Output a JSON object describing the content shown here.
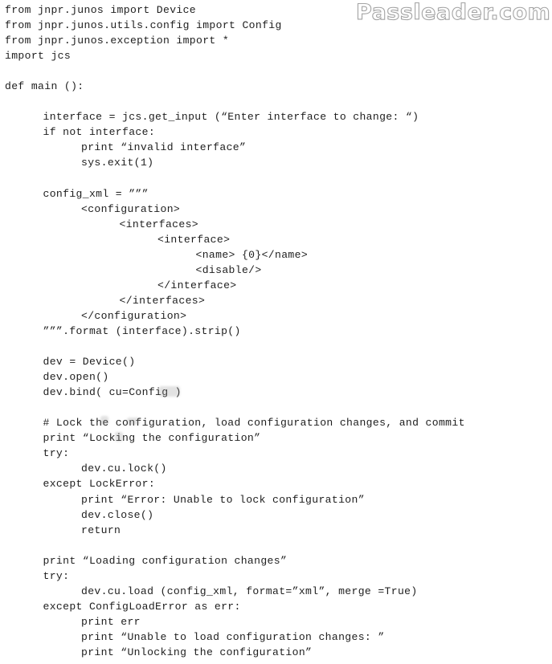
{
  "watermark": "Passleader.com",
  "code_lines": [
    {
      "indent": 0,
      "text": "from jnpr.junos import Device"
    },
    {
      "indent": 0,
      "text": "from jnpr.junos.utils.config import Config"
    },
    {
      "indent": 0,
      "text": "from jnpr.junos.exception import *"
    },
    {
      "indent": 0,
      "text": "import jcs"
    },
    {
      "indent": 0,
      "text": ""
    },
    {
      "indent": 0,
      "text": "def main ():"
    },
    {
      "indent": 0,
      "text": ""
    },
    {
      "indent": 1,
      "text": "interface = jcs.get_input (“Enter interface to change: “)"
    },
    {
      "indent": 1,
      "text": "if not interface:"
    },
    {
      "indent": 2,
      "text": "print “invalid interface”"
    },
    {
      "indent": 2,
      "text": "sys.exit(1)"
    },
    {
      "indent": 0,
      "text": ""
    },
    {
      "indent": 1,
      "text": "config_xml = ”””"
    },
    {
      "indent": 2,
      "text": "<configuration>"
    },
    {
      "indent": 3,
      "text": "<interfaces>"
    },
    {
      "indent": 4,
      "text": "<interface>"
    },
    {
      "indent": 5,
      "text": "<name> {0}</name>"
    },
    {
      "indent": 5,
      "text": "<disable/>"
    },
    {
      "indent": 4,
      "text": "</interface>"
    },
    {
      "indent": 3,
      "text": "</interfaces>"
    },
    {
      "indent": 2,
      "text": "</configuration>"
    },
    {
      "indent": 1,
      "text": "”””.format (interface).strip()"
    },
    {
      "indent": 0,
      "text": ""
    },
    {
      "indent": 1,
      "text": "dev = Device()"
    },
    {
      "indent": 1,
      "text": "dev.open()"
    },
    {
      "indent": 1,
      "text": "dev.bind( cu=Config )"
    },
    {
      "indent": 0,
      "text": ""
    },
    {
      "indent": 1,
      "text": "# Lock the configuration, load configuration changes, and commit"
    },
    {
      "indent": 1,
      "text": "print “Locking the configuration”"
    },
    {
      "indent": 1,
      "text": "try:"
    },
    {
      "indent": 2,
      "text": "dev.cu.lock()"
    },
    {
      "indent": 1,
      "text": "except LockError:"
    },
    {
      "indent": 2,
      "text": "print “Error: Unable to lock configuration”"
    },
    {
      "indent": 2,
      "text": "dev.close()"
    },
    {
      "indent": 2,
      "text": "return"
    },
    {
      "indent": 0,
      "text": ""
    },
    {
      "indent": 1,
      "text": "print “Loading configuration changes”"
    },
    {
      "indent": 1,
      "text": "try:"
    },
    {
      "indent": 2,
      "text": "dev.cu.load (config_xml, format=”xml”, merge =True)"
    },
    {
      "indent": 1,
      "text": "except ConfigLoadError as err:"
    },
    {
      "indent": 2,
      "text": "print err"
    },
    {
      "indent": 2,
      "text": "print “Unable to load configuration changes: ”"
    },
    {
      "indent": 2,
      "text": "print “Unlocking the configuration”"
    }
  ]
}
